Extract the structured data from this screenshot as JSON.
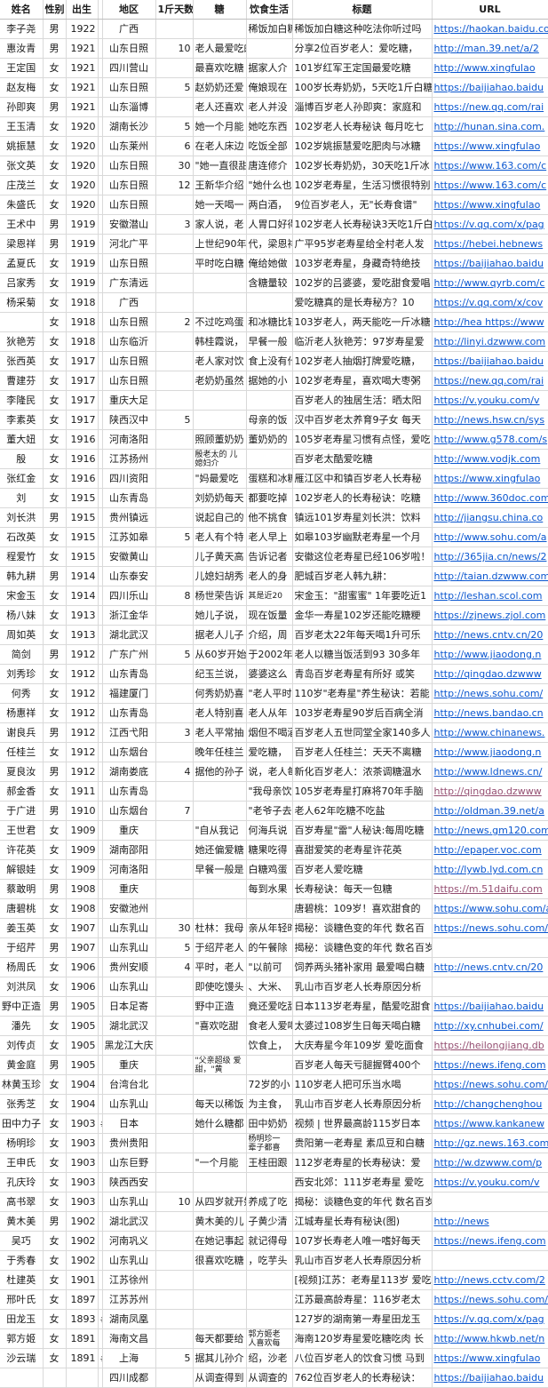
{
  "headers": [
    "姓名",
    "性别",
    "出生",
    "",
    "地区",
    "1斤天数",
    "糖",
    "饮食生活",
    "标题",
    "URL"
  ],
  "rows": [
    [
      "李子尧",
      "男",
      "1922",
      "",
      "广西",
      "",
      "",
      "稀饭加白糖这种吃法你听过吗",
      "稀饭加白糖这种吃法你听过吗",
      "https://haokan.baidu.com"
    ],
    [
      "惠汝青",
      "男",
      "1921",
      "",
      "山东日照",
      "10",
      "老人最爱吃的是糖，",
      "",
      "分享2位百岁老人：爱吃糖，",
      "http://man.39.net/a/2"
    ],
    [
      "王定国",
      "女",
      "1921",
      "",
      "四川营山",
      "",
      "最喜欢吃糖",
      "据家人介",
      "101岁红军王定国最爱吃糖",
      "http://www.xingfulao"
    ],
    [
      "赵友梅",
      "女",
      "1921",
      "",
      "山东日照",
      "5",
      "赵奶奶还爱",
      "俺娘现在",
      "100岁长寿奶奶，5天吃1斤白糖",
      "https://baijiahao.baidu"
    ],
    [
      "孙即爽",
      "男",
      "1921",
      "",
      "山东淄博",
      "",
      "老人还喜欢",
      "老人并没",
      "淄博百岁老人孙即爽：家庭和",
      "https://new.qq.com/rai"
    ],
    [
      "王玉清",
      "女",
      "1920",
      "",
      "湖南长沙",
      "5",
      "她一个月能",
      "她吃东西",
      "102岁老人长寿秘诀 每月吃七",
      "http://hunan.sina.com."
    ],
    [
      "姚振慧",
      "女",
      "1920",
      "",
      "山东莱州",
      "6",
      "在老人床边",
      "吃饭全部",
      "102岁姚振慧爱吃肥肉与冰糖",
      "https://www.xingfulao"
    ],
    [
      "张文英",
      "女",
      "1920",
      "",
      "山东日照",
      "30",
      "\"她一直很甜",
      "唐连修介",
      "102岁长寿奶奶，30天吃1斤冰",
      "https://www.163.com/c"
    ],
    [
      "庄茂兰",
      "女",
      "1920",
      "",
      "山东日照",
      "12",
      "王新华介绍",
      "\"她什么也",
      "102岁老寿星，生活习惯很特别",
      "https://www.163.com/c"
    ],
    [
      "朱盛氏",
      "女",
      "1920",
      "",
      "山东日照",
      "",
      "她一天喝一",
      "两白酒，",
      "9位百岁老人，无\"长寿食谱\"",
      "https://www.xingfulao"
    ],
    [
      "王术中",
      "男",
      "1919",
      "",
      "安徽潜山",
      "3",
      "家人说，老",
      "人胃口好得",
      "102岁老人长寿秘诀3天吃1斤白",
      "https://v.qq.com/x/pag"
    ],
    [
      "梁恩祥",
      "男",
      "1919",
      "",
      "河北广平",
      "",
      "上世纪90年",
      "代，梁恩祥",
      "广平95岁老寿星给全村老人发",
      "https://hebei.hebnews"
    ],
    [
      "孟夏氏",
      "女",
      "1919",
      "",
      "山东日照",
      "",
      "平时吃白糖",
      "俺给她做",
      "103岁老寿星，身藏奇特绝技",
      "https://baijiahao.baidu"
    ],
    [
      "吕家秀",
      "女",
      "1919",
      "",
      "广东清远",
      "",
      "",
      "含糖量较",
      "102岁的吕婆婆，爱吃甜食爱唱",
      "http://www.qyrb.com/c"
    ],
    [
      "杨采菊",
      "女",
      "1918",
      "",
      "广西",
      "",
      "",
      "",
      "爱吃糖真的是长寿秘方？10",
      "https://v.qq.com/x/cov"
    ],
    [
      "",
      "女",
      "1918",
      "",
      "山东日照",
      "2",
      "不过吃鸡蛋",
      "和冰糖比较",
      "103岁老人，两天能吃一斤冰糖",
      "http://hea https://www"
    ],
    [
      "狄艳芳",
      "女",
      "1918",
      "",
      "山东临沂",
      "",
      "韩桂霞说，",
      "早餐一般",
      "临沂老人狄艳芳：97岁寿星爱",
      "http://linyi.dzwww.com"
    ],
    [
      "张西英",
      "女",
      "1917",
      "",
      "山东日照",
      "",
      "老人家对饮",
      "食上没有什",
      "102岁老人抽烟打牌爱吃糖，",
      "https://baijiahao.baidu"
    ],
    [
      "曹建芬",
      "女",
      "1917",
      "",
      "山东日照",
      "",
      "老奶奶虽然",
      "据她的小",
      "102岁老寿星，喜欢喝大枣粥",
      "https://new.qq.com/rai"
    ],
    [
      "李隆民",
      "女",
      "1917",
      "",
      "重庆大足",
      "",
      "",
      "",
      "百岁老人的独居生活：晒太阳",
      "https://v.youku.com/v"
    ],
    [
      "李素英",
      "女",
      "1917",
      "",
      "陕西汉中",
      "5",
      "",
      "母亲的饭",
      "汉中百岁老太养育9子女 每天",
      "http://news.hsw.cn/sys"
    ],
    [
      "董大妞",
      "女",
      "1916",
      "",
      "河南洛阳",
      "",
      "照顾董奶奶",
      "董奶奶的",
      "105岁老寿星习惯有点怪，爱吃",
      "http://www.g578.com/s"
    ],
    [
      "殷",
      "女",
      "1916",
      "",
      "江苏扬州",
      "",
      "殷老太的 儿媳妇介",
      "",
      "百岁老太酷爱吃糖",
      "http://www.vodjk.com"
    ],
    [
      "张红金",
      "女",
      "1916",
      "",
      "四川资阳",
      "",
      "\"妈最爱吃",
      "蛋糕和冰糖",
      "雁江区中和镇百岁老人长寿秘",
      "https://www.xingfulao"
    ],
    [
      "刘",
      "女",
      "1915",
      "",
      "山东青岛",
      "",
      "刘奶奶每天",
      "都要吃掉",
      "102岁老人的长寿秘诀：吃糖",
      "http://www.360doc.com"
    ],
    [
      "刘长洪",
      "男",
      "1915",
      "",
      "贵州镇远",
      "",
      "说起自己的",
      "他不挑食",
      "镇远101岁寿星刘长洪：饮料",
      "http://jiangsu.china.co"
    ],
    [
      "石改英",
      "女",
      "1915",
      "",
      "江苏如皋",
      "5",
      "老人有个特",
      "老人早上",
      "如皋103岁幽默老寿星一个月",
      "http://www.sohu.com/a"
    ],
    [
      "程爱竹",
      "女",
      "1915",
      "",
      "安徽黄山",
      "",
      "儿子黄天高",
      "告诉记者",
      "安徽这位老寿星已经106岁啦！",
      "http://365jia.cn/news/2"
    ],
    [
      "韩九耕",
      "男",
      "1914",
      "",
      "山东泰安",
      "",
      "儿媳妇胡秀",
      "老人的身",
      "肥城百岁老人韩九耕：",
      "http://taian.dzwww.com"
    ],
    [
      "宋金玉",
      "女",
      "1914",
      "",
      "四川乐山",
      "8",
      "杨世荣告诉",
      "其是近20",
      "宋金玉：\"甜蜜蜜\" 1年要吃近1",
      "http://leshan.scol.com"
    ],
    [
      "杨八妹",
      "女",
      "1913",
      "",
      "浙江金华",
      "",
      "她儿子说，",
      "现在饭量",
      "金华一寿星102岁还能吃糖粳",
      "https://zjnews.zjol.com"
    ],
    [
      "周如英",
      "女",
      "1913",
      "",
      "湖北武汉",
      "",
      "据老人儿子",
      "介绍，周",
      "百岁老太22年每天喝1升可乐",
      "http://news.cntv.cn/20"
    ],
    [
      "简剑",
      "男",
      "1912",
      "",
      "广东广州",
      "5",
      "从60岁开始",
      "于2002年",
      "老人以糖当饭活到93  30多年",
      "http://www.jiaodong.n"
    ],
    [
      "刘秀珍",
      "女",
      "1912",
      "",
      "山东青岛",
      "",
      "纪玉兰说，",
      "婆婆这么",
      "青岛百岁老寿星有所好 或笑",
      "http://qingdao.dzwww"
    ],
    [
      "何秀",
      "女",
      "1912",
      "",
      "福建厦门",
      "",
      "何秀奶奶喜",
      "\"老人平时",
      "110岁\"老寿星\"养生秘诀：若能",
      "http://news.sohu.com/"
    ],
    [
      "杨惠祥",
      "女",
      "1912",
      "",
      "山东青岛",
      "",
      "老人特别喜",
      "老人从年",
      "103岁老寿星90岁后百病全消",
      "http://news.bandao.cn"
    ],
    [
      "谢良兵",
      "男",
      "1912",
      "",
      "江西弋阳",
      "3",
      "老人平常抽",
      "烟但不喝酒",
      "百岁老人五世同堂全家140多人",
      "http://www.chinanews."
    ],
    [
      "任桂兰",
      "女",
      "1912",
      "",
      "山东烟台",
      "",
      "晚年任桂兰",
      "爱吃糖，",
      "百岁老人任桂兰：天天不离糖",
      "http://www.jiaodong.n"
    ],
    [
      "夏良汝",
      "男",
      "1912",
      "",
      "湖南娄底",
      "4",
      "据他的孙子",
      "说，老人每",
      "新化百岁老人：浓茶调糖温水",
      "http://www.ldnews.cn/"
    ],
    [
      "郝金香",
      "女",
      "1911",
      "",
      "山东青岛",
      "",
      "",
      "\"我母亲饮",
      "105岁老寿星打麻将70年手脑",
      "http://qingdao.dzwww"
    ],
    [
      "于广进",
      "男",
      "1910",
      "",
      "山东烟台",
      "7",
      "",
      "\"老爷子去",
      "老人62年吃糖不吃盐",
      "http://oldman.39.net/a"
    ],
    [
      "王世君",
      "女",
      "1909",
      "",
      "重庆",
      "",
      "\"自从我记",
      "何海兵说",
      "百岁寿星\"雷\"人秘诀:每周吃糖",
      "http://news.gm120.com"
    ],
    [
      "许花英",
      "女",
      "1909",
      "",
      "湖南邵阳",
      "",
      "她还偏爱糖",
      "糖果吃得",
      "喜甜爱笑的老寿星许花英",
      "http://epaper.voc.com"
    ],
    [
      "解银娃",
      "女",
      "1909",
      "",
      "河南洛阳",
      "",
      "早餐一般是",
      "白糖鸡蛋",
      "百岁老人爱吃糖",
      "http://lywb.lyd.com.cn"
    ],
    [
      "蔡敢明",
      "男",
      "1908",
      "",
      "重庆",
      "",
      "",
      "每到水果",
      "长寿秘诀：每天一包糖",
      "https://m.51daifu.com"
    ],
    [
      "唐碧桃",
      "女",
      "1908",
      "",
      "安徽池州",
      "",
      "",
      "",
      "唐碧桃：109岁！喜欢甜食的",
      "https://www.sohu.com/a"
    ],
    [
      "姜玉英",
      "女",
      "1907",
      "",
      "山东乳山",
      "30",
      "杜林：我母",
      "亲从年轻时",
      "揭秘：谈糖色变的年代 数名百",
      "https://news.sohu.com/"
    ],
    [
      "于绍芹",
      "男",
      "1907",
      "",
      "山东乳山",
      "5",
      "于绍芹老人",
      "的午餐除",
      "揭秘：谈糖色变的年代 数名百岁老人却无糖不欢",
      ""
    ],
    [
      "杨周氏",
      "女",
      "1906",
      "",
      "贵州安顺",
      "4",
      "平时，老人",
      "\"以前可",
      "饲养两头猪补家用 最爱喝白糖",
      "http://news.cntv.cn/20"
    ],
    [
      "刘洪凤",
      "女",
      "1906",
      "",
      "山东乳山",
      "",
      "即使吃馒头",
      "、大米、",
      "乳山市百岁老人长寿原因分析",
      ""
    ],
    [
      "野中正造",
      "男",
      "1905",
      "",
      "日本足寄",
      "",
      "野中正造",
      "竟还爱吃甜",
      "日本113岁老寿星，酷爱吃甜食",
      "https://baijiahao.baidu"
    ],
    [
      "潘先",
      "女",
      "1905",
      "",
      "湖北武汉",
      "",
      "\"喜欢吃甜",
      "食老人爱喝",
      "太婆过108岁生日每天喝白糖",
      "http://xy.cnhubei.com/"
    ],
    [
      "刘传贞",
      "女",
      "1905",
      "",
      "黑龙江大庆",
      "",
      "",
      "饮食上，",
      "大庆寿星今年109岁 爱吃面食",
      "https://heilongjiang.db"
    ],
    [
      "黄金庭",
      "男",
      "1905",
      "",
      "重庆",
      "",
      "\"父亲超级 爱甜，\"黄",
      "",
      "百岁老人每天亏腿握臂400个",
      "https://news.ifeng.com"
    ],
    [
      "林黄玉珍",
      "女",
      "1904",
      "",
      "台湾台北",
      "",
      "",
      "72岁的小",
      "110岁老人把可乐当水喝",
      "https://news.sohu.com/"
    ],
    [
      "张秀芝",
      "女",
      "1904",
      "",
      "山东乳山",
      "",
      "每天以稀饭",
      "为主食，",
      "乳山市百岁老人长寿原因分析",
      "http://changchenghou"
    ],
    [
      "田中力子",
      "女",
      "1903",
      "#",
      "日本",
      "",
      "她什么糖都",
      "田中奶奶",
      "视频 | 世界最高龄115岁日本",
      "https://www.kankanew"
    ],
    [
      "杨明珍",
      "女",
      "1903",
      "",
      "贵州贵阳",
      "",
      "",
      "杨明珍一 辈子都喜",
      "贵阳第一老寿星 素瓜豆和白糖",
      "http://gz.news.163.com"
    ],
    [
      "王申氏",
      "女",
      "1903",
      "",
      "山东巨野",
      "",
      "\"一个月能",
      "王桂田跟",
      "112岁老寿星的长寿秘诀：爱",
      "http://w.dzwww.com/p"
    ],
    [
      "孔庆玲",
      "女",
      "1903",
      "",
      "陕西西安",
      "",
      "",
      "",
      "西安北郊：111岁老寿星 爱吃",
      "https://v.youku.com/v"
    ],
    [
      "高书翠",
      "女",
      "1903",
      "",
      "山东乳山",
      "10",
      "从四岁就开始",
      "养成了吃",
      "揭秘：谈糖色变的年代 数名百岁老人却无糖不欢",
      ""
    ],
    [
      "黄木美",
      "男",
      "1902",
      "",
      "湖北武汉",
      "",
      "黄木美的儿",
      "子黄少清",
      "江城寿星长寿有秘诀(图)",
      "http://news"
    ],
    [
      "吴巧",
      "女",
      "1902",
      "",
      "河南巩义",
      "",
      "在她记事起",
      "就记得母",
      "107岁长寿老人唯一嗜好每天",
      "https://news.ifeng.com"
    ],
    [
      "于秀春",
      "女",
      "1902",
      "",
      "山东乳山",
      "",
      "很喜欢吃糖",
      "，吃芋头",
      "乳山市百岁老人长寿原因分析",
      ""
    ],
    [
      "杜建英",
      "女",
      "1901",
      "",
      "江苏徐州",
      "",
      "",
      "",
      "[视频]江苏：老寿星113岁 爱吃",
      "http://news.cctv.com/2"
    ],
    [
      "邢叶氏",
      "女",
      "1897",
      "",
      "江苏苏州",
      "",
      "",
      "",
      "江苏最高龄寿星：116岁老太",
      "https://news.sohu.com/"
    ],
    [
      "田龙玉",
      "女",
      "1893",
      "#",
      "湖南凤凰",
      "",
      "",
      "",
      "127岁的湖南第一寿星田龙玉",
      "https://v.qq.com/x/pag"
    ],
    [
      "郭方姬",
      "女",
      "1891",
      "",
      "海南文昌",
      "",
      "每天都要给",
      "郭方姬老 人喜欢每",
      "海南120岁寿星爱吃糖吃肉 长",
      "http://www.hkwb.net/n"
    ],
    [
      "沙云瑞",
      "女",
      "1891",
      "#",
      "上海",
      "5",
      "据其儿孙介",
      "绍，沙老",
      "八位百岁老人的饮食习惯 马到",
      "https://www.xingfulao"
    ],
    [
      "",
      "",
      "",
      "",
      "四川成都",
      "",
      "从调查得到",
      "从调查的",
      "762位百岁老人的长寿秘诀：",
      "https://baijiahao.baidu"
    ]
  ],
  "small_cells": [
    [
      22,
      6
    ],
    [
      29,
      7
    ],
    [
      53,
      6
    ],
    [
      57,
      7
    ],
    [
      67,
      7
    ]
  ],
  "visited_rows": [
    39,
    44,
    52
  ]
}
